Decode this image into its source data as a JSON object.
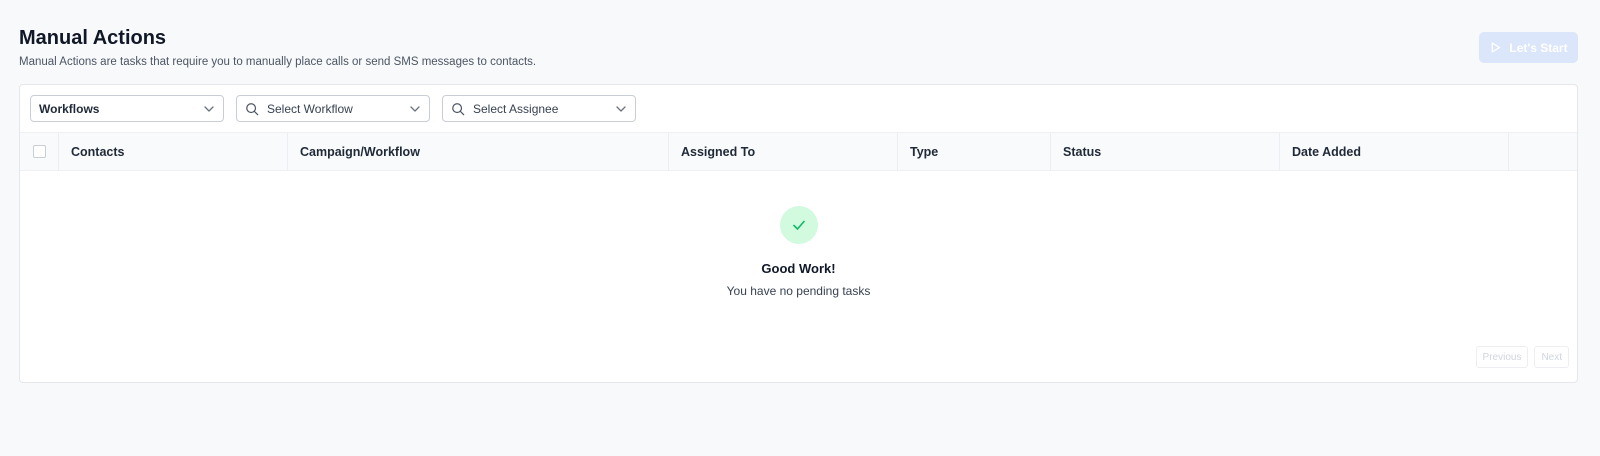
{
  "header": {
    "title": "Manual Actions",
    "subtitle": "Manual Actions are tasks that require you to manually place calls or send SMS messages to contacts."
  },
  "start_button": {
    "label": "Let's Start",
    "icon": "play-icon",
    "color": "#dbe6fb"
  },
  "filters": {
    "workflows_select": {
      "value": "Workflows"
    },
    "workflow_select": {
      "placeholder": "Select Workflow",
      "icon": "search-icon"
    },
    "assignee_select": {
      "placeholder": "Select Assignee",
      "icon": "search-icon"
    }
  },
  "table": {
    "columns": [
      "Contacts",
      "Campaign/Workflow",
      "Assigned To",
      "Type",
      "Status",
      "Date Added"
    ]
  },
  "empty_state": {
    "icon": "check-icon",
    "title": "Good Work!",
    "message": "You have no pending tasks",
    "icon_bg": "#d1fadf",
    "icon_color": "#12b76a"
  },
  "pagination": {
    "previous_label": "Previous",
    "next_label": "Next"
  }
}
